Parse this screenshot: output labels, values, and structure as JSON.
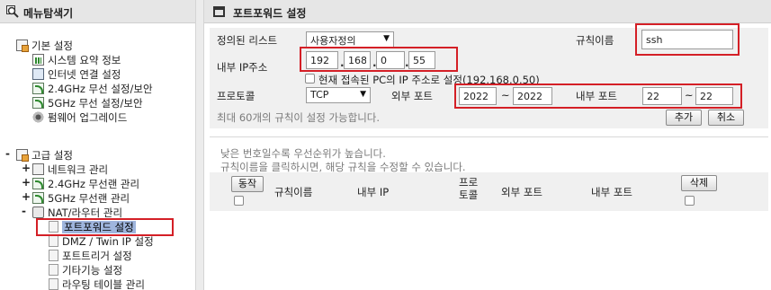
{
  "left_panel": {
    "title": "메뉴탐색기",
    "basic": {
      "label": "기본 설정",
      "items": [
        "시스템 요약 정보",
        "인터넷 연결 설정",
        "2.4GHz 무선 설정/보안",
        "5GHz 무선 설정/보안",
        "펌웨어 업그레이드"
      ]
    },
    "advanced": {
      "label": "고급 설정",
      "groups": [
        {
          "label": "네트워크 관리",
          "toggle": "+"
        },
        {
          "label": "2.4GHz 무선랜 관리",
          "toggle": "+"
        },
        {
          "label": "5GHz 무선랜 관리",
          "toggle": "+"
        },
        {
          "label": "NAT/라우터 관리",
          "toggle": "-"
        }
      ],
      "nat_items": [
        "포트포워드 설정",
        "DMZ / Twin IP 설정",
        "포트트리거 설정",
        "기타기능 설정",
        "라우팅 테이블 관리"
      ]
    },
    "collapse_symbol": "-"
  },
  "right_panel": {
    "title": "포트포워드 설정",
    "defined_list_label": "정의된 리스트",
    "defined_list_value": "사용자정의",
    "rule_name_label": "규칙이름",
    "rule_name_value": "ssh",
    "internal_ip_label": "내부 IP주소",
    "ip": [
      "192",
      "168",
      "0",
      "55"
    ],
    "ip_dot": ".",
    "current_ip_checkbox_label": "현재 접속된 PC의 IP 주소로 설정(192.168.0.50)",
    "protocol_label": "프로토콜",
    "protocol_value": "TCP",
    "external_port_label": "외부 포트",
    "external_port_from": "2022",
    "external_port_to": "2022",
    "internal_port_label": "내부 포트",
    "internal_port_from": "22",
    "internal_port_to": "22",
    "tilde": "~",
    "max_rules_note": "최대 60개의 규칙이 설정 가능합니다.",
    "add_button": "추가",
    "cancel_button": "취소",
    "priority_note": "낮은 번호일수록 우선순위가 높습니다.",
    "edit_note": "규칙이름을 클릭하시면, 해당 규칙을 수정할 수 있습니다.",
    "table": {
      "action_button": "동작",
      "columns": [
        "규칙이름",
        "내부 IP",
        "프로\n토콜",
        "외부 포트",
        "내부 포트"
      ],
      "delete_button": "삭제"
    }
  }
}
